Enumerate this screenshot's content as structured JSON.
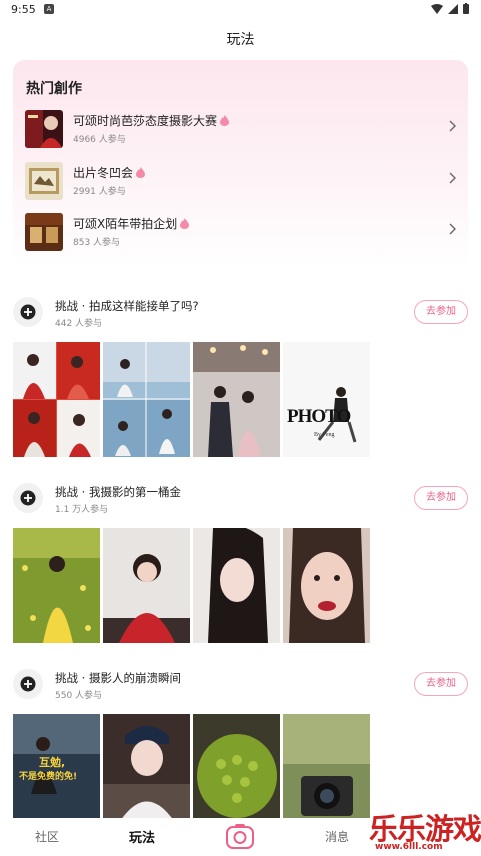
{
  "status_bar": {
    "time": "9:55",
    "notif_letter": "A"
  },
  "header": {
    "title": "玩法"
  },
  "hot": {
    "title": "热门創作",
    "items": [
      {
        "name": "可颂时尚芭莎态度摄影大赛",
        "count": "4966 人参与"
      },
      {
        "name": "出片冬凹会",
        "count": "2991 人参与"
      },
      {
        "name": "可颂X陌年带拍企划",
        "count": "853 人参与"
      }
    ]
  },
  "challenges": [
    {
      "name": "挑战 · 拍成这样能接单了吗?",
      "count": "442 人参与",
      "join_label": "去参加",
      "photo4_text": "PHOTO",
      "photo4_sub": "By Peng"
    },
    {
      "name": "挑战 · 我摄影的第一桶金",
      "count": "1.1 万人参与",
      "join_label": "去参加"
    },
    {
      "name": "挑战 · 摄影人的崩溃瞬间",
      "count": "550 人参与",
      "join_label": "去参加",
      "photo1_text_a": "互勉,",
      "photo1_text_b": "不是免费的免!"
    }
  ],
  "nav": {
    "tab1": "社区",
    "tab2": "玩法",
    "tab4": "消息"
  },
  "watermark": {
    "text": "乐乐游戏",
    "url": "www.6lll.com"
  },
  "colors": {
    "accent": "#ee5f88",
    "hot_bg": "#fde6ee"
  }
}
